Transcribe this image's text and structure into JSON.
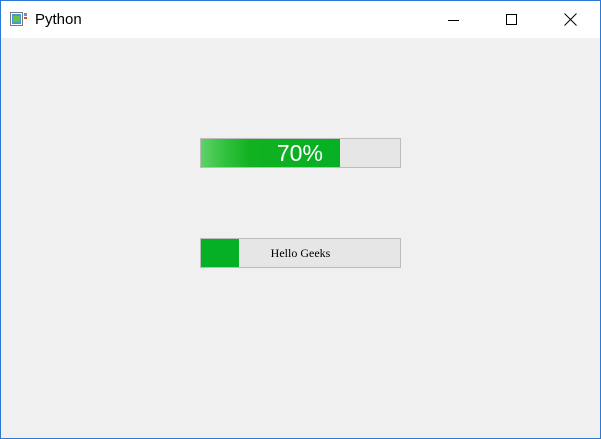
{
  "window": {
    "title": "Python",
    "icon": "python-app-icon",
    "buttons": {
      "minimize": "minimize-icon",
      "maximize": "maximize-icon",
      "close": "close-icon"
    }
  },
  "progress_bar_1": {
    "value_percent": 70,
    "label": "70%",
    "color": "#06b025"
  },
  "progress_bar_2": {
    "value_percent": 19,
    "label": "Hello Geeks",
    "color": "#06b025"
  },
  "colors": {
    "accent": "#06b025",
    "track": "#e6e6e6",
    "background": "#f0f0f0",
    "border": "#2b79d4"
  }
}
